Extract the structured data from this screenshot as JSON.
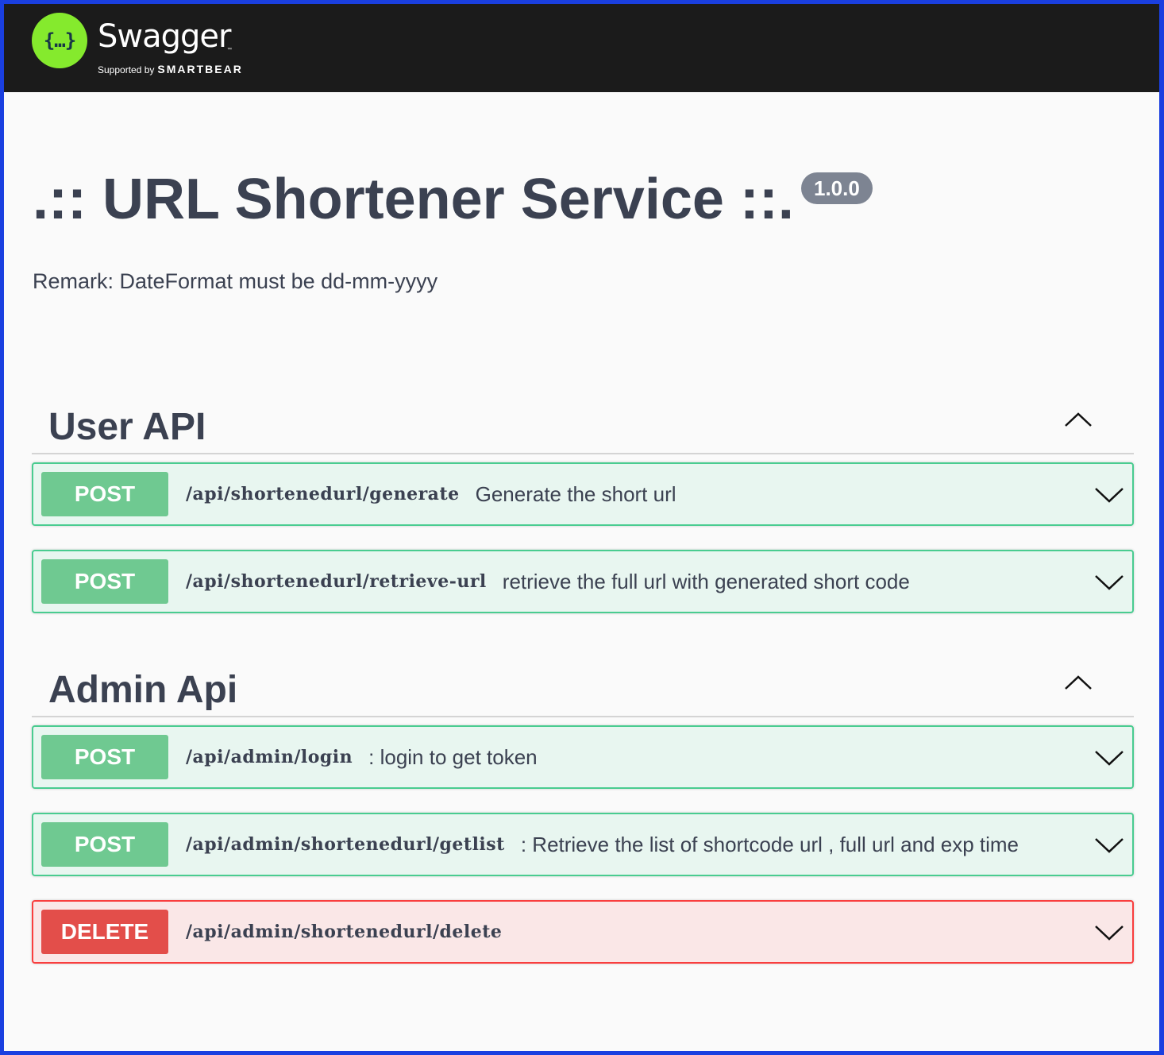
{
  "header": {
    "logo_glyph": "{…}",
    "brand_name": "Swagger",
    "brand_tm": "™",
    "supported_by": "Supported by",
    "smartbear": "SMARTBEAR",
    "colors": {
      "bar": "#1b1b1b",
      "logo": "#85ea2d"
    }
  },
  "info": {
    "title": ".:: URL Shortener Service ::.",
    "version": "1.0.0",
    "description": "Remark: DateFormat must be dd-mm-yyyy"
  },
  "sections": [
    {
      "name": "User API",
      "expanded": true,
      "operations": [
        {
          "method": "POST",
          "path": "/api/shortenedurl/generate",
          "summary": "Generate the short url"
        },
        {
          "method": "POST",
          "path": "/api/shortenedurl/retrieve-url",
          "summary": "retrieve the full url with generated short code"
        }
      ]
    },
    {
      "name": "Admin Api",
      "expanded": true,
      "operations": [
        {
          "method": "POST",
          "path": "/api/admin/login",
          "summary": ": login to get token"
        },
        {
          "method": "POST",
          "path": "/api/admin/shortenedurl/getlist",
          "summary": ": Retrieve the list of shortcode url , full url and exp time"
        },
        {
          "method": "DELETE",
          "path": "/api/admin/shortenedurl/delete",
          "summary": ""
        }
      ]
    }
  ],
  "method_colors": {
    "post": {
      "border": "#49cc90",
      "bg": "#e8f6f0",
      "badge": "#6fc991"
    },
    "delete": {
      "border": "#f93e3e",
      "bg": "#fae7e7",
      "badge": "#e34e4a"
    }
  },
  "icons": {
    "collapse": "chevron-up-icon",
    "expand": "chevron-down-icon"
  }
}
